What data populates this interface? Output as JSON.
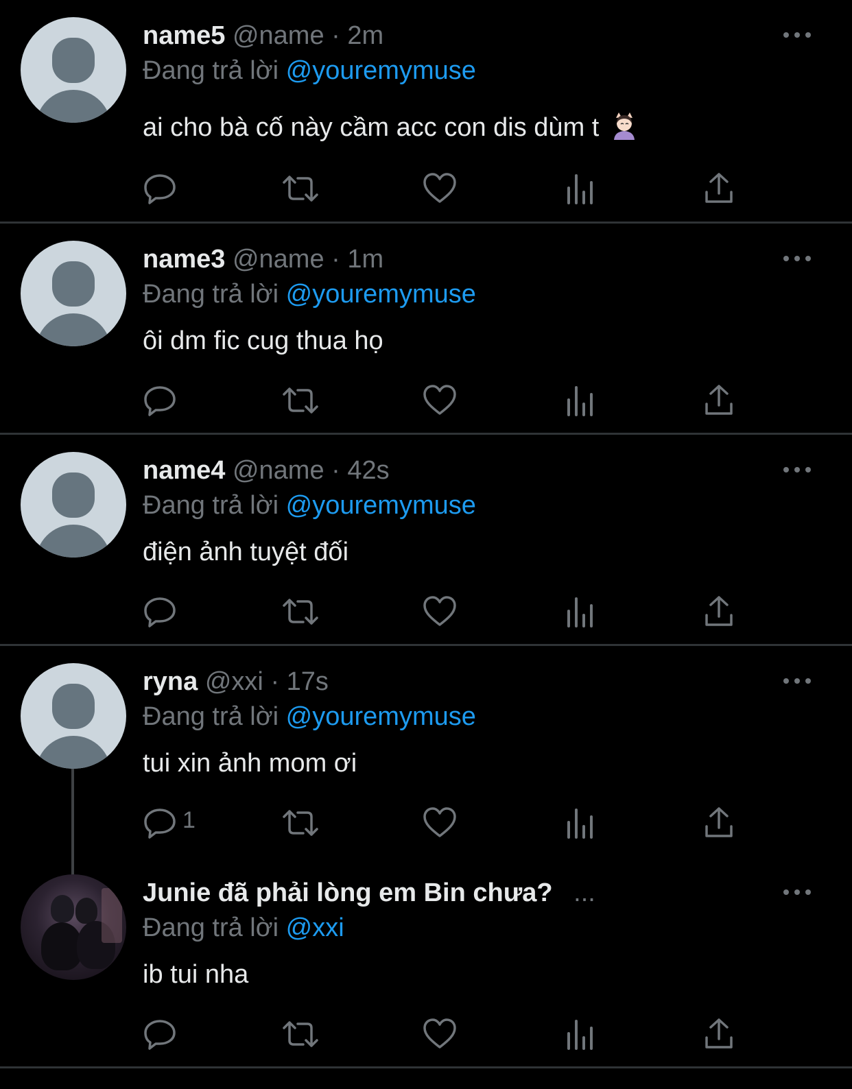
{
  "tweets": [
    {
      "display_name": "name5",
      "handle": "@name",
      "time": "2m",
      "reply_prefix": "Đang trả lời",
      "reply_to": "@youremymuse",
      "text": "ai cho bà cố này cầm acc con dis dùm t",
      "emoji": "woman-gesturing-emoji",
      "reply_count": ""
    },
    {
      "display_name": "name3",
      "handle": "@name",
      "time": "1m",
      "reply_prefix": "Đang trả lời",
      "reply_to": "@youremymuse",
      "text": "ôi dm fic cug thua họ",
      "reply_count": ""
    },
    {
      "display_name": "name4",
      "handle": "@name",
      "time": "42s",
      "reply_prefix": "Đang trả lời",
      "reply_to": "@youremymuse",
      "text": "điện ảnh tuyệt đối",
      "reply_count": ""
    },
    {
      "display_name": "ryna",
      "handle": "@xxi",
      "time": "17s",
      "reply_prefix": "Đang trả lời",
      "reply_to": "@youremymuse",
      "text": "tui xin ảnh mom ơi",
      "reply_count": "1"
    },
    {
      "display_name": "Junie đã phải lòng em Bin chưa?",
      "handle": "",
      "time": "",
      "truncation": "...",
      "reply_prefix": "Đang trả lời",
      "reply_to": "@xxi",
      "text": "ib tui nha",
      "reply_count": ""
    }
  ],
  "separator": "·",
  "icons": {
    "reply": "reply-icon",
    "retweet": "retweet-icon",
    "like": "heart-icon",
    "views": "views-icon",
    "share": "share-icon",
    "more": "more-icon"
  },
  "colors": {
    "background": "#000000",
    "text": "#e7e9ea",
    "secondary": "#71767b",
    "mention": "#1d9bf0",
    "divider": "#2f3336"
  }
}
